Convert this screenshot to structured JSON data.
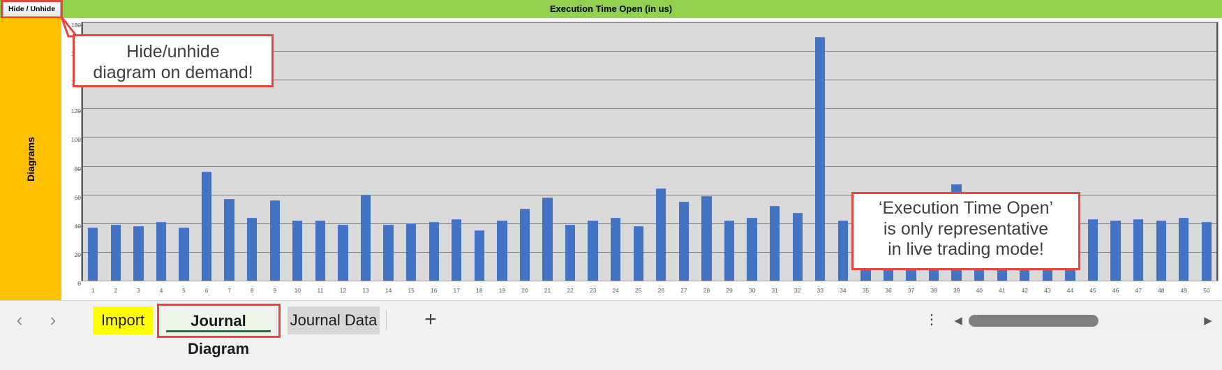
{
  "titlebar": {
    "title": "Execution Time Open (in us)",
    "hide_unhide_label": "Hide / Unhide",
    "background_color": "#92d050"
  },
  "sidebar": {
    "label": "Diagrams",
    "background_color": "#ffc000"
  },
  "callouts": [
    {
      "id": "hide",
      "line1": "Hide/unhide",
      "line2": "diagram on demand!",
      "border_color": "#e8453c"
    },
    {
      "id": "exec",
      "line1": "‘Execution Time Open’",
      "line2": "is only representative",
      "line3": "in live trading mode!",
      "border_color": "#e8453c"
    }
  ],
  "tabbar": {
    "prev_label": "‹",
    "next_label": "›",
    "tabs": [
      {
        "label": "Import",
        "active": false,
        "color": "#ffff00"
      },
      {
        "label": "Journal Diagram",
        "active": true,
        "color": "#eef6ec"
      },
      {
        "label": "Journal Data",
        "active": false,
        "color": "#d6d6d6"
      }
    ],
    "add_sheet_label": "+",
    "options_label": "⋮",
    "scroll_left_label": "◀",
    "scroll_right_label": "▶"
  },
  "chart_data": {
    "type": "bar",
    "title": "Execution Time Open (in us)",
    "xlabel": "",
    "ylabel": "",
    "ylim": [
      0,
      180
    ],
    "yticks": [
      0,
      20,
      40,
      60,
      80,
      100,
      120,
      140,
      160,
      180
    ],
    "grid": true,
    "legend": "none",
    "bar_color": "#4472c4",
    "plot_background": "#d9d9d9",
    "categories": [
      "1",
      "2",
      "3",
      "4",
      "5",
      "6",
      "7",
      "8",
      "9",
      "10",
      "11",
      "12",
      "13",
      "14",
      "15",
      "16",
      "17",
      "18",
      "19",
      "20",
      "21",
      "22",
      "23",
      "24",
      "25",
      "26",
      "27",
      "28",
      "29",
      "30",
      "31",
      "32",
      "33",
      "34",
      "35",
      "36",
      "37",
      "38",
      "39",
      "40",
      "41",
      "42",
      "43",
      "44",
      "45",
      "46",
      "47",
      "48",
      "49",
      "50"
    ],
    "values": [
      37,
      39,
      38,
      41,
      37,
      76,
      57,
      44,
      56,
      42,
      42,
      39,
      60,
      39,
      40,
      41,
      43,
      35,
      42,
      50,
      58,
      39,
      42,
      44,
      38,
      64,
      55,
      59,
      42,
      44,
      52,
      47,
      170,
      42,
      40,
      43,
      44,
      38,
      67,
      42,
      44,
      47,
      43,
      44,
      43,
      42,
      43,
      42,
      44,
      41
    ]
  }
}
